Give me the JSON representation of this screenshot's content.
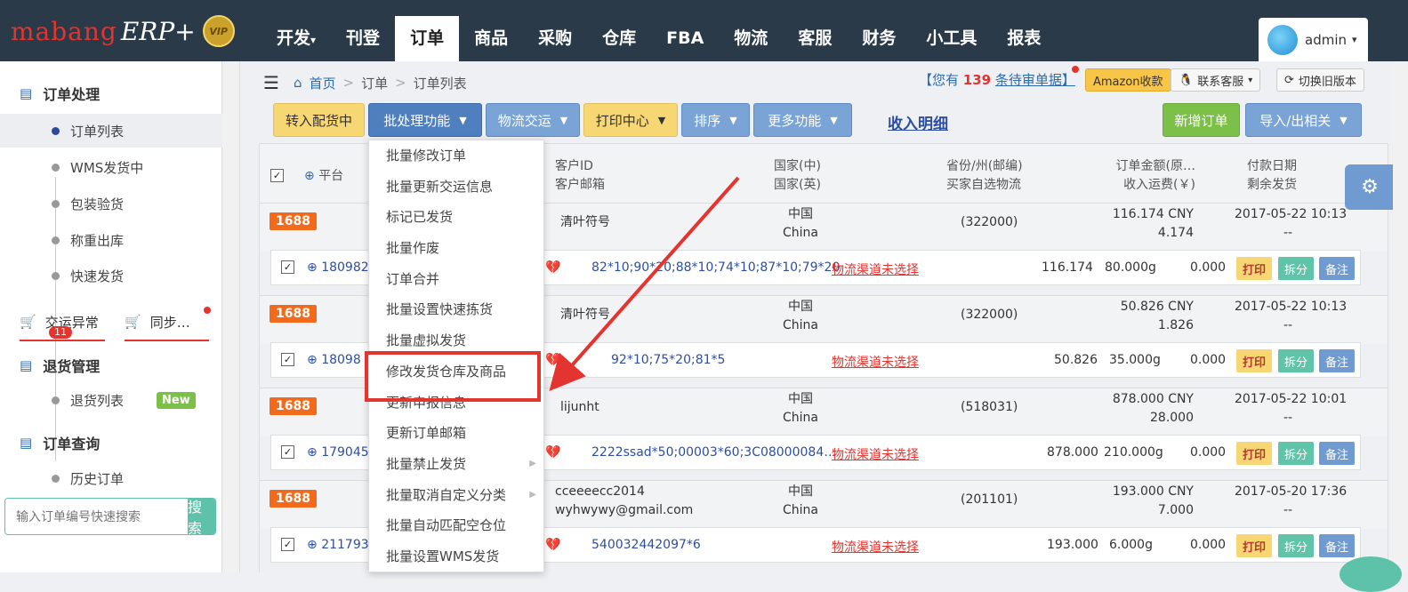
{
  "brand": {
    "name": "mabang",
    "erp": "ERP+",
    "vip": "VIP"
  },
  "nav": [
    {
      "label": "开发",
      "caret": "▾"
    },
    {
      "label": "刊登"
    },
    {
      "label": "订单",
      "active": true
    },
    {
      "label": "商品"
    },
    {
      "label": "采购"
    },
    {
      "label": "仓库"
    },
    {
      "label": "FBA"
    },
    {
      "label": "物流"
    },
    {
      "label": "客服"
    },
    {
      "label": "财务"
    },
    {
      "label": "小工具"
    },
    {
      "label": "报表"
    }
  ],
  "user": {
    "name": "admin",
    "caret": "▾"
  },
  "sidebar": {
    "group1": "订单处理",
    "items1": [
      "订单列表",
      "WMS发货中",
      "包装验货",
      "称重出库",
      "快速发货"
    ],
    "tab_exception": "交运异常",
    "tab_exception_count": "11",
    "tab_sync": "同步…",
    "group2": "退货管理",
    "items2": [
      "退货列表"
    ],
    "new_badge": "New",
    "group3": "订单查询",
    "items3": [
      "历史订单"
    ],
    "search_placeholder": "输入订单编号快速搜索",
    "search_button": "搜索"
  },
  "breadcrumb": {
    "home": "首页",
    "sep": ">",
    "level1": "订单",
    "level2": "订单列表"
  },
  "notice": {
    "prefix": "【您有",
    "count": "139",
    "suffix": "条待审单据】"
  },
  "top_buttons": {
    "amazon": "Amazon收款",
    "service": "联系客服",
    "switch": "切换旧版本"
  },
  "toolbar": {
    "to_picking": "转入配货中",
    "batch": "批处理功能",
    "ship": "物流交运",
    "print": "打印中心",
    "sort": "排序",
    "more": "更多功能",
    "income": "收入明细",
    "new_order": "新增订单",
    "import_export": "导入/出相关"
  },
  "table_header": {
    "platform": "平台",
    "customer_id": "客户ID",
    "customer_email": "客户邮箱",
    "country_cn": "国家(中)",
    "country_en": "国家(英)",
    "province": "省份/州(邮编)",
    "buyer_shipping": "买家自选物流",
    "amount": "订单金额(原…",
    "shipping_income": "收入运费(￥)",
    "pay_date": "付款日期",
    "remaining": "剩余发货"
  },
  "orders": [
    {
      "platform": "1688",
      "customer": "清叶符号",
      "email": "",
      "country_cn": "中国",
      "country_en": "China",
      "zip": "(322000)",
      "amount": "116.174 CNY",
      "freight": "4.174",
      "date": "2017-05-22 10:13",
      "remain": "--",
      "order_no": "180982",
      "skus": "82*10;90*20;88*10;74*10;87*10;79*20",
      "logistics": "物流渠道未选择",
      "total": "116.174",
      "weight": "80.000g",
      "fee": "0.000"
    },
    {
      "platform": "1688",
      "customer": "清叶符号",
      "email": "",
      "country_cn": "中国",
      "country_en": "China",
      "zip": "(322000)",
      "amount": "50.826 CNY",
      "freight": "1.826",
      "date": "2017-05-22 10:13",
      "remain": "--",
      "order_no": "18098",
      "skus": "92*10;75*20;81*5",
      "logistics": "物流渠道未选择",
      "total": "50.826",
      "weight": "35.000g",
      "fee": "0.000"
    },
    {
      "platform": "1688",
      "customer": "lijunht",
      "email": "",
      "country_cn": "中国",
      "country_en": "China",
      "zip": "(518031)",
      "amount": "878.000 CNY",
      "freight": "28.000",
      "date": "2017-05-22 10:01",
      "remain": "--",
      "order_no": "179045",
      "skus": "2222ssad*50;00003*60;3C08000084…",
      "logistics": "物流渠道未选择",
      "total": "878.000",
      "weight": "210.000g",
      "fee": "0.000"
    },
    {
      "platform": "1688",
      "customer": "cceeeecc2014",
      "email": "wyhwywy@gmail.com",
      "country_cn": "中国",
      "country_en": "China",
      "zip": "(201101)",
      "amount": "193.000 CNY",
      "freight": "7.000",
      "date": "2017-05-20 17:36",
      "remain": "--",
      "order_no": "211793",
      "skus": "540032442097*6",
      "logistics": "物流渠道未选择",
      "total": "193.000",
      "weight": "6.000g",
      "fee": "0.000"
    }
  ],
  "row_buttons": {
    "print": "打印",
    "split": "拆分",
    "note": "备注"
  },
  "batch_menu": [
    "批量修改订单",
    "批量更新交运信息",
    "标记已发货",
    "批量作废",
    "订单合并",
    "批量设置快速拣货",
    "批量虚拟发货",
    "修改发货仓库及商品",
    "更新申报信息",
    "更新订单邮箱",
    "批量禁止发货",
    "批量取消自定义分类",
    "批量自动匹配空仓位",
    "批量设置WMS发货"
  ],
  "colors": {
    "topbar": "#2a3a49",
    "accent_red": "#e3342f",
    "brand_blue": "#2b6cb0",
    "badge_orange": "#f26b1d"
  }
}
